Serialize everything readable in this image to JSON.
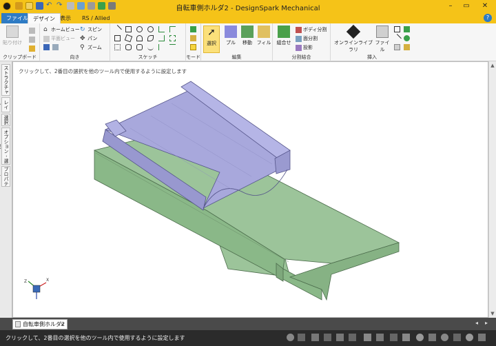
{
  "window": {
    "title": "自転車側ホルダ2 - DesignSpark Mechanical"
  },
  "tabs": [
    {
      "label": "ファイル(F)"
    },
    {
      "label": "デザイン"
    },
    {
      "label": "表示"
    },
    {
      "label": "RS / Allied"
    }
  ],
  "clipboard": {
    "paste_label": "貼り付け",
    "group_label": "クリップボード"
  },
  "orient": {
    "home_label": "ホームビュー",
    "plan_label": "平面ビュー",
    "spin_label": "スピン",
    "pan_label": "パン",
    "zoom_label": "ズーム",
    "group_label": "向き"
  },
  "sketch": {
    "group_label": "スケッチ"
  },
  "mode": {
    "group_label": "モード"
  },
  "edit": {
    "select_label": "選択",
    "pull_label": "プル",
    "move_label": "移動",
    "fill_label": "フィル",
    "group_label": "編集"
  },
  "intersect": {
    "combine_label": "組合せ",
    "split_body_label": "ボディ分割",
    "split_face_label": "面分割",
    "project_label": "投影",
    "group_label": "分割結合"
  },
  "insert": {
    "online_library_label": "オンラインライブラリ",
    "file_label": "ファイル",
    "group_label": "挿入"
  },
  "side_panels": [
    {
      "label": "ストラクチャー"
    },
    {
      "label": "レイヤ"
    },
    {
      "label": "選択"
    },
    {
      "label": "オプション - 選択"
    },
    {
      "label": "プロパティ"
    }
  ],
  "canvas": {
    "hint": "クリックして、2番目の選択を他のツール内で使用するように設定します"
  },
  "doc_tab": {
    "label": "自転車側ホルダ2",
    "close": "×"
  },
  "status": {
    "text": "クリックして、2番目の選択を他のツール内で使用するように設定します"
  },
  "colors": {
    "title_bar": "#f5c318",
    "model_base": "#9cc49a",
    "model_cradle": "#a4a4d8"
  }
}
